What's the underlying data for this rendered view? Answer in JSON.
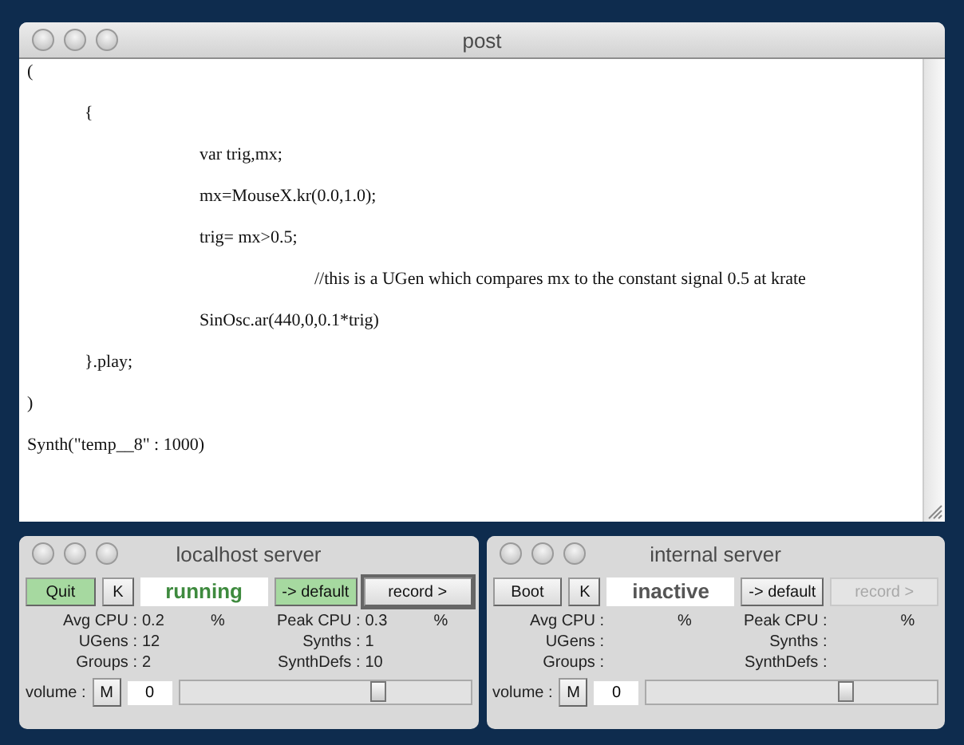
{
  "post_window": {
    "title": "post",
    "lines": [
      "(",
      "\t{",
      "\t\t\tvar trig,mx;",
      "\t\t\tmx=MouseX.kr(0.0,1.0);",
      "\t\t\ttrig= mx>0.5;",
      "\t\t\t\t\t//this is a UGen which compares mx to the constant signal 0.5 at krate",
      "\t\t\tSinOsc.ar(440,0,0.1*trig)",
      "\t}.play;",
      ")",
      "Synth(\"temp__8\" : 1000)"
    ]
  },
  "servers": [
    {
      "title": "localhost server",
      "boot_button": {
        "label": "Quit",
        "on": true
      },
      "kill_button": "K",
      "status": "running",
      "running": true,
      "default_button": {
        "label": "-> default",
        "selected": true
      },
      "record_button": {
        "label": "record >",
        "disabled": false
      },
      "stats": [
        {
          "label": "Avg CPU :",
          "value": "0.2",
          "unit": "%"
        },
        {
          "label": "Peak CPU :",
          "value": "0.3",
          "unit": "%"
        },
        {
          "label": "UGens :",
          "value": "12"
        },
        {
          "label": "Synths :",
          "value": "1"
        },
        {
          "label": "Groups :",
          "value": "2"
        },
        {
          "label": "SynthDefs :",
          "value": "10"
        }
      ],
      "volume": {
        "label": "volume :",
        "mute_button": "M",
        "value": "0",
        "level": 0.69
      }
    },
    {
      "title": "internal server",
      "boot_button": {
        "label": "Boot",
        "on": false
      },
      "kill_button": "K",
      "status": "inactive",
      "running": false,
      "default_button": {
        "label": "-> default",
        "selected": false
      },
      "record_button": {
        "label": "record >",
        "disabled": true
      },
      "stats": [
        {
          "label": "Avg CPU :",
          "unit": "%"
        },
        {
          "label": "Peak CPU :",
          "unit": "%"
        },
        {
          "label": "UGens :"
        },
        {
          "label": "Synths :"
        },
        {
          "label": "Groups :"
        },
        {
          "label": "SynthDefs :"
        }
      ],
      "volume": {
        "label": "volume :",
        "mute_button": "M",
        "value": "0",
        "level": 0.69
      }
    }
  ]
}
